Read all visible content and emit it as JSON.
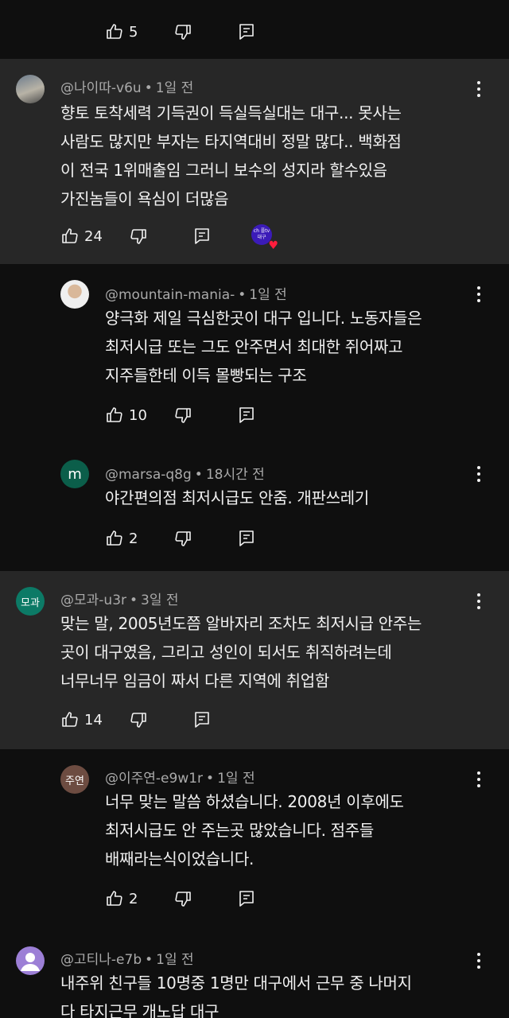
{
  "top_actions": {
    "likes": "5"
  },
  "comments": [
    {
      "avatar_text": "",
      "handle": "@나이따-v6u",
      "time": "1일 전",
      "lines": [
        "향토 토착세력 기득권이 득실득실대는 대구... 못사는",
        "사람도 많지만 부자는 타지역대비 정말 많다.. 백화점",
        "이 전국 1위매출임 그러니 보수의 성지라 할수있음",
        "가진놈들이 욕심이 더많음"
      ],
      "likes": "24",
      "creator_heart_text": "ch 플tv 대구"
    },
    {
      "avatar_text": "",
      "handle": "@mountain-mania-",
      "time": "1일 전",
      "lines": [
        "양극화 제일 극심한곳이 대구 입니다. 노동자들은",
        "최저시급 또는 그도 안주면서 최대한 쥐어짜고",
        "지주들한테 이득 몰빵되는 구조"
      ],
      "likes": "10"
    },
    {
      "avatar_text": "m",
      "handle": "@marsa-q8g",
      "time": "18시간 전",
      "lines": [
        "야간편의점 최저시급도 안줌. 개판쓰레기"
      ],
      "likes": "2"
    },
    {
      "avatar_text": "모과",
      "handle": "@모과-u3r",
      "time": "3일 전",
      "lines": [
        "맞는 말, 2005년도쯤 알바자리 조차도 최저시급 안주는",
        "곳이 대구였음, 그리고 성인이 되서도 취직하려는데",
        "너무너무 임금이 짜서 다른 지역에 취업함"
      ],
      "likes": "14"
    },
    {
      "avatar_text": "주연",
      "handle": "@이주연-e9w1r",
      "time": "1일 전",
      "lines": [
        "너무 맞는 말씀 하셨습니다. 2008년 이후에도",
        "최저시급도 안 주는곳 많았습니다. 점주들",
        "배째라는식이었습니다."
      ],
      "likes": "2"
    },
    {
      "avatar_text": "",
      "handle": "@고티나-e7b",
      "time": "1일 전",
      "lines": [
        "내주위 친구들 10명중 1명만 대구에서 근무 중 나머지",
        "다 타지근무 개노답 대구"
      ],
      "likes": ""
    }
  ],
  "colors": {
    "background": "#0f0f0f",
    "highlight": "#272727",
    "meta_text": "#aaaaaa",
    "avatar_m": "#0b5e4a",
    "avatar_mogwa": "#0c7a66",
    "avatar_juyeon": "#6d4c41",
    "avatar_purple": "#9c7fd6"
  }
}
